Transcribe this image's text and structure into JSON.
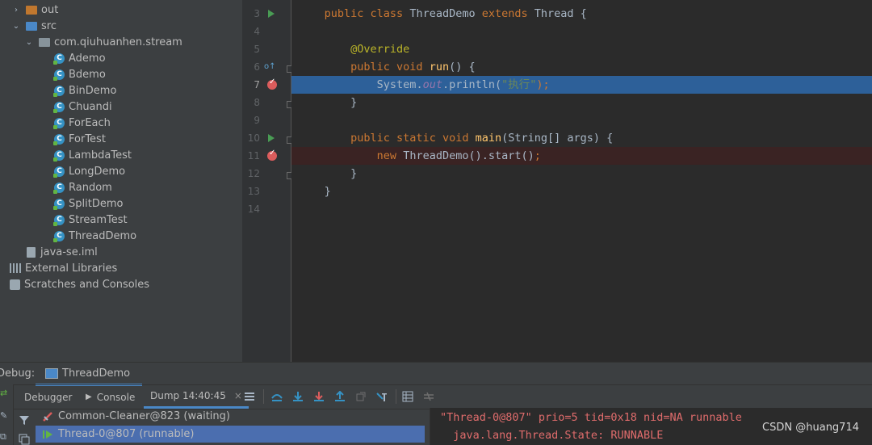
{
  "project_tree": {
    "items": [
      {
        "label": "out",
        "type": "folder-orange",
        "indent": 1,
        "arrow": "›"
      },
      {
        "label": "src",
        "type": "folder-blue",
        "indent": 1,
        "arrow": "⌄"
      },
      {
        "label": "com.qiuhuanhen.stream",
        "type": "pkg",
        "indent": 2,
        "arrow": "⌄"
      },
      {
        "label": "Ademo",
        "type": "class",
        "indent": 3
      },
      {
        "label": "Bdemo",
        "type": "class",
        "indent": 3
      },
      {
        "label": "BinDemo",
        "type": "class",
        "indent": 3
      },
      {
        "label": "Chuandi",
        "type": "class",
        "indent": 3
      },
      {
        "label": "ForEach",
        "type": "class",
        "indent": 3
      },
      {
        "label": "ForTest",
        "type": "class",
        "indent": 3
      },
      {
        "label": "LambdaTest",
        "type": "class",
        "indent": 3
      },
      {
        "label": "LongDemo",
        "type": "class",
        "indent": 3
      },
      {
        "label": "Random",
        "type": "class",
        "indent": 3
      },
      {
        "label": "SplitDemo",
        "type": "class",
        "indent": 3
      },
      {
        "label": "StreamTest",
        "type": "class",
        "indent": 3
      },
      {
        "label": "ThreadDemo",
        "type": "class",
        "indent": 3
      },
      {
        "label": "java-se.iml",
        "type": "file",
        "indent": 1
      },
      {
        "label": "External Libraries",
        "type": "lib",
        "indent": 0
      },
      {
        "label": "Scratches and Consoles",
        "type": "scratch",
        "indent": 0
      }
    ]
  },
  "editor": {
    "line_numbers": [
      "3",
      "4",
      "5",
      "6",
      "7",
      "8",
      "9",
      "10",
      "11",
      "12",
      "13",
      "14"
    ],
    "current_line": "7",
    "lines": {
      "l3": [
        "public class ",
        "ThreadDemo ",
        "extends ",
        "Thread {"
      ],
      "l5": "@Override",
      "l6": [
        "public void ",
        "run",
        "() {"
      ],
      "l7": [
        "System.",
        "out",
        ".println(",
        "\"执行\"",
        ");"
      ],
      "l8": "}",
      "l10": [
        "public static void ",
        "main",
        "(String[] args) {"
      ],
      "l11": [
        "new ",
        "ThreadDemo().start()",
        ";"
      ],
      "l12": "}",
      "l13": "}"
    }
  },
  "debug": {
    "label": "Debug:",
    "run_tab": "ThreadDemo",
    "tabs": [
      "Debugger",
      "Console",
      "Dump 14:40:45"
    ],
    "close_glyph": "×",
    "threads": [
      {
        "label": "Common-Cleaner@823 (waiting)",
        "state": "waiting"
      },
      {
        "label": "Thread-0@807 (runnable)",
        "state": "runnable",
        "selected": true
      }
    ],
    "dump_lines": [
      "\"Thread-0@807\" prio=5 tid=0x18 nid=NA runnable",
      "  java.lang.Thread.State: RUNNABLE"
    ]
  },
  "watermark": "CSDN @huang714",
  "colors": {
    "keyword": "#cc7832",
    "function": "#ffc66d",
    "annotation": "#bbb529",
    "string": "#6a8759",
    "field": "#9876aa",
    "selection": "#2d6099",
    "breakpoint_line": "#3a2323",
    "dump_text": "#e06c6c"
  }
}
